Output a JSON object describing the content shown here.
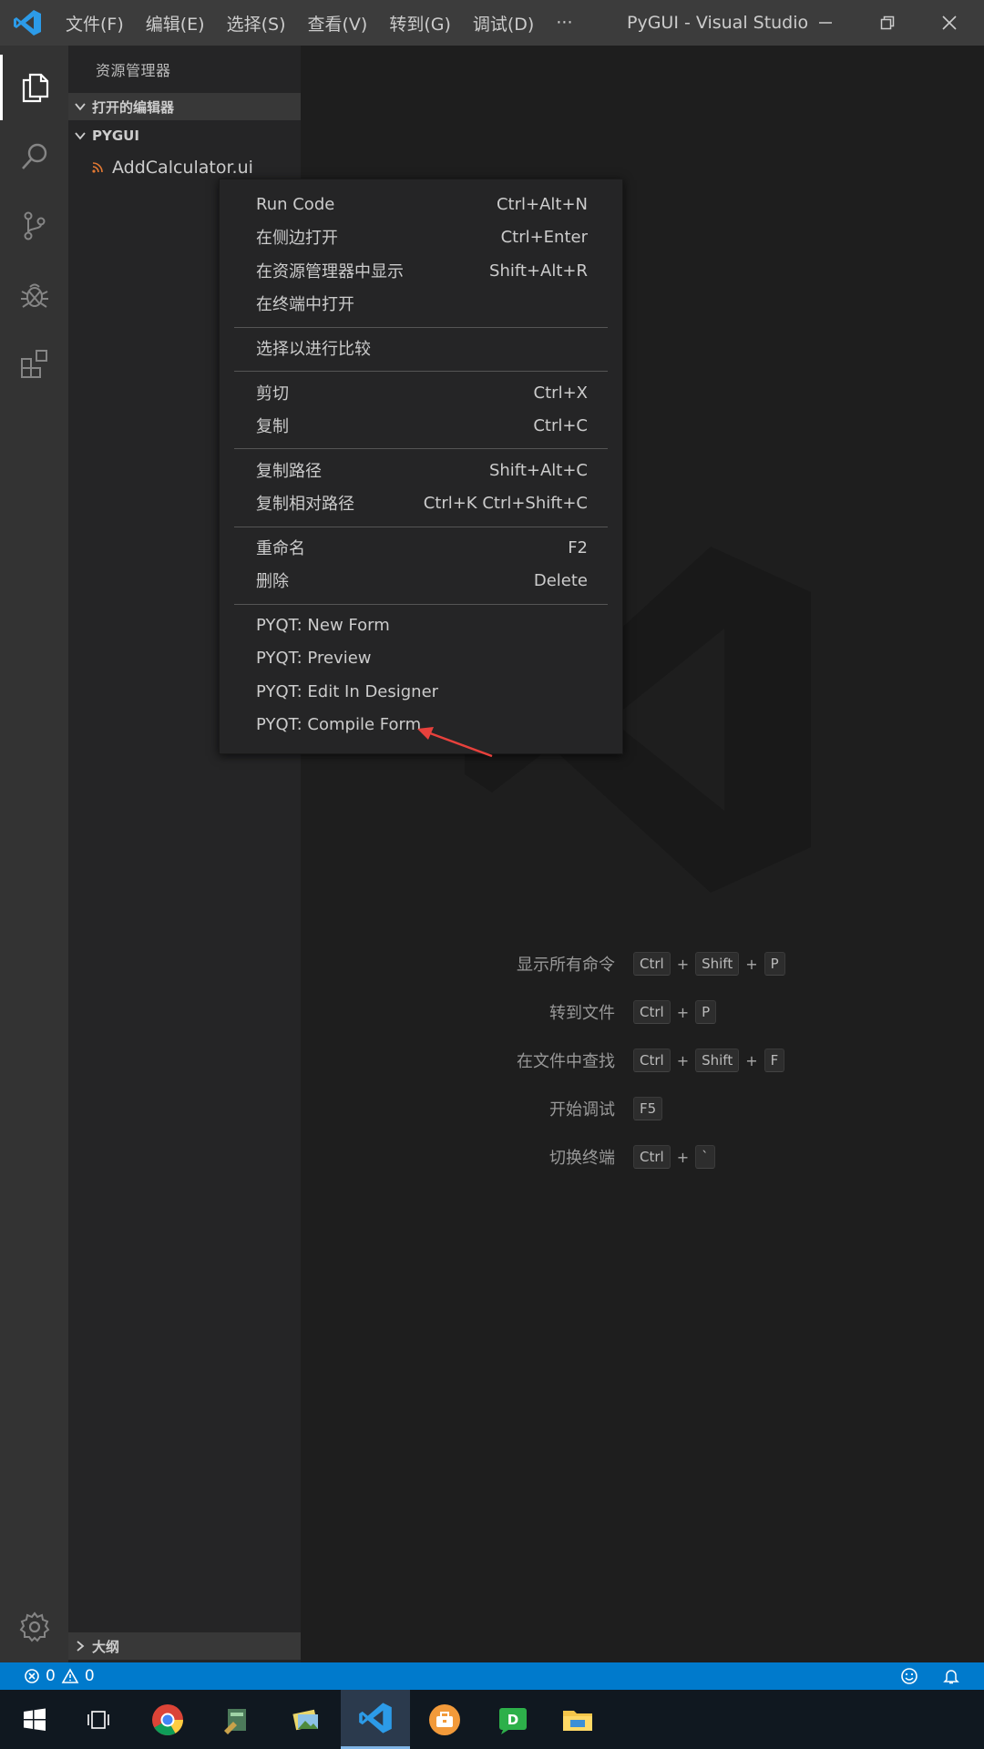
{
  "titlebar": {
    "menu": [
      "文件(F)",
      "编辑(E)",
      "选择(S)",
      "查看(V)",
      "转到(G)",
      "调试(D)",
      "···"
    ],
    "title": "PyGUI - Visual Studio..."
  },
  "activity_bar": {
    "icons": [
      "explorer-icon",
      "search-icon",
      "source-control-icon",
      "debug-icon",
      "extensions-icon",
      "gear-icon"
    ]
  },
  "sidebar": {
    "title": "资源管理器",
    "open_editors_label": "打开的编辑器",
    "folder_label": "PYGUI",
    "file_name": "AddCalculator.ui",
    "outline_label": "大纲"
  },
  "context_menu": {
    "groups": [
      [
        {
          "label": "Run Code",
          "shortcut": "Ctrl+Alt+N"
        },
        {
          "label": "在侧边打开",
          "shortcut": "Ctrl+Enter"
        },
        {
          "label": "在资源管理器中显示",
          "shortcut": "Shift+Alt+R"
        },
        {
          "label": "在终端中打开",
          "shortcut": ""
        }
      ],
      [
        {
          "label": "选择以进行比较",
          "shortcut": ""
        }
      ],
      [
        {
          "label": "剪切",
          "shortcut": "Ctrl+X"
        },
        {
          "label": "复制",
          "shortcut": "Ctrl+C"
        }
      ],
      [
        {
          "label": "复制路径",
          "shortcut": "Shift+Alt+C"
        },
        {
          "label": "复制相对路径",
          "shortcut": "Ctrl+K Ctrl+Shift+C"
        }
      ],
      [
        {
          "label": "重命名",
          "shortcut": "F2"
        },
        {
          "label": "删除",
          "shortcut": "Delete"
        }
      ],
      [
        {
          "label": "PYQT: New Form",
          "shortcut": ""
        },
        {
          "label": "PYQT: Preview",
          "shortcut": ""
        },
        {
          "label": "PYQT: Edit In Designer",
          "shortcut": ""
        },
        {
          "label": "PYQT: Compile Form",
          "shortcut": ""
        }
      ]
    ]
  },
  "shortcuts": [
    {
      "label": "显示所有命令",
      "keys": [
        "Ctrl",
        "Shift",
        "P"
      ]
    },
    {
      "label": "转到文件",
      "keys": [
        "Ctrl",
        "P"
      ]
    },
    {
      "label": "在文件中查找",
      "keys": [
        "Ctrl",
        "Shift",
        "F"
      ]
    },
    {
      "label": "开始调试",
      "keys": [
        "F5"
      ]
    },
    {
      "label": "切换终端",
      "keys": [
        "Ctrl",
        "`"
      ]
    }
  ],
  "statusbar": {
    "errors": "0",
    "warnings": "0"
  },
  "colors": {
    "accent": "#007acc",
    "annotation_arrow": "#e8413c"
  }
}
